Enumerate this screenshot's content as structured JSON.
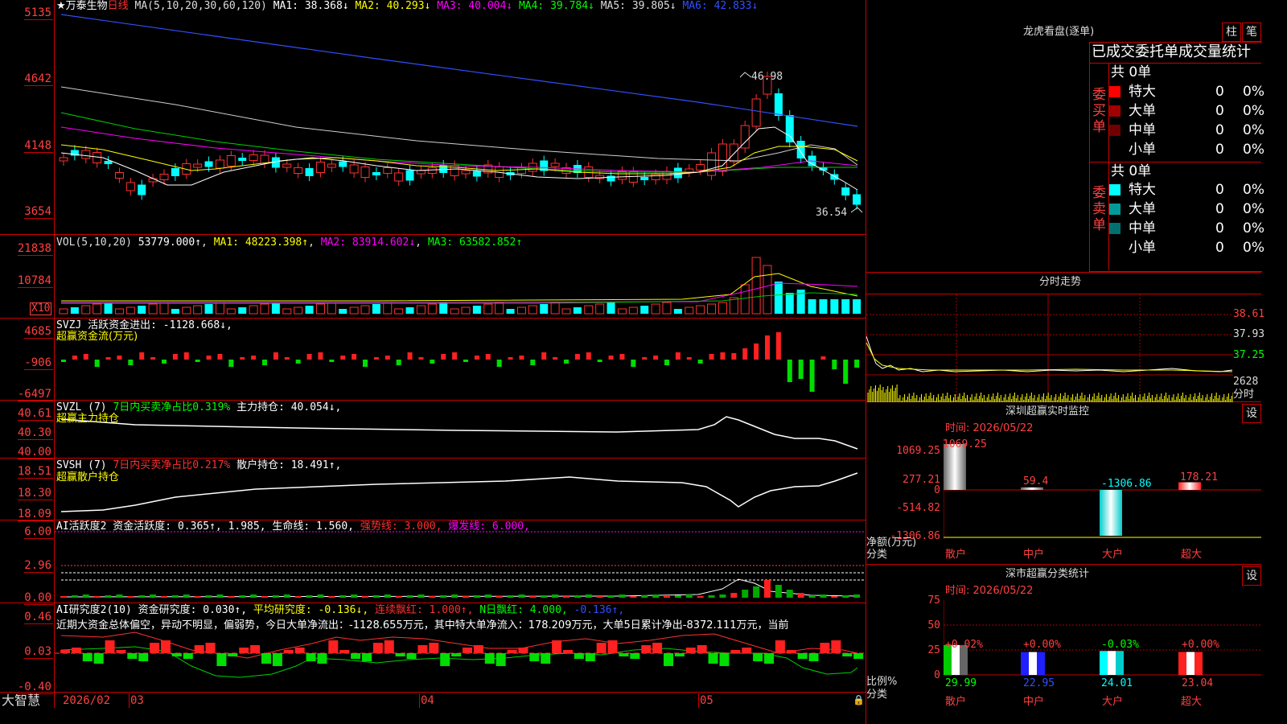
{
  "chart": {
    "stock_name": "★万泰生物",
    "period": "日线",
    "ma_params": "MA(5,10,20,30,60,120)",
    "ma_values": [
      {
        "label": "MA1: 38.368↓",
        "color": "#ffffff"
      },
      {
        "label": "MA2: 40.293↓",
        "color": "#ffff00"
      },
      {
        "label": "MA3: 40.004↓",
        "color": "#ff00ff"
      },
      {
        "label": "MA4: 39.784↓",
        "color": "#00ff00"
      },
      {
        "label": "MA5: 39.805↓",
        "color": "#dddddd"
      },
      {
        "label": "MA6: 42.833↓",
        "color": "#3050ff"
      }
    ],
    "price_axis": [
      "5135",
      "4642",
      "4148",
      "3654"
    ],
    "high_mark": "46.98",
    "low_mark": "36.54",
    "vol_header": "VOL(5,10,20)",
    "vol_value": "53779.000↑",
    "vol_mas": [
      {
        "label": "MA1: 48223.398↑",
        "color": "#ffff00"
      },
      {
        "label": "MA2: 83914.602↓",
        "color": "#ff00ff"
      },
      {
        "label": "MA3: 63582.852↑",
        "color": "#00ff00"
      }
    ],
    "vol_axis": [
      "21838",
      "10784"
    ],
    "vol_unit": "X10",
    "svzj_header": "SVZJ  活跃资金进出: -1128.668↓,",
    "svzj_name": "超赢资金流(万元)",
    "svzj_axis": [
      "4685",
      "-906",
      "-6497"
    ],
    "svzl_header_a": "SVZL (7)",
    "svzl_header_b": "7日内买卖净占比0.319%",
    "svzl_header_c": "主力持仓: 40.054↓,",
    "svzl_name": "超赢主力持仓",
    "svzl_axis": [
      "40.61",
      "40.30",
      "40.00"
    ],
    "svsh_header_a": "SVSH (7)",
    "svsh_header_b": "7日内买卖净占比0.217%",
    "svsh_header_c": "散户持仓: 18.491↑,",
    "svsh_name": "超赢散户持仓",
    "svsh_axis": [
      "18.51",
      "18.30",
      "18.09"
    ],
    "ai1_header_a": "AI活跃度2 资金活跃度: 0.365↑, 1.985, 生命线: 1.560,",
    "ai1_header_b": "强势线: 3.000,",
    "ai1_header_c": "爆发线: 6.000,",
    "ai1_axis": [
      "6.00",
      "2.96",
      "0.00"
    ],
    "ai2_header_a": "AI研究度2(10) 资金研究度: 0.030↑,",
    "ai2_header_b": "平均研究度: -0.136↓,",
    "ai2_header_c": "连续飘红: 1.000↑,",
    "ai2_header_d": "N日飘红: 4.000,",
    "ai2_header_e": "-0.136↑,",
    "ai2_text": "近期大资金总体偏空，异动不明显，偏弱势，今日大单净流出：-1128.655万元，其中特大单净流入：178.209万元，大单5日累计净出-8372.111万元，当前",
    "ai2_axis": [
      "0.46",
      "0.03",
      "-0.40"
    ],
    "date_labels": [
      "2026/02",
      "03",
      "04",
      "05"
    ],
    "brand": "大智慧"
  },
  "longhu": {
    "title": "龙虎看盘(逐单)",
    "btn_zhu": "柱",
    "btn_bi": "笔",
    "tabs": "已成交委托单成交量统计",
    "buy_label": "委买单",
    "sell_label": "委卖单",
    "buy_total": "共 0单",
    "sell_total": "共 0单",
    "buy_rows": [
      {
        "name": "特大",
        "count": "0",
        "pct": "0%",
        "color": "#ff0000"
      },
      {
        "name": "大单",
        "count": "0",
        "pct": "0%",
        "color": "#a00000"
      },
      {
        "name": "中单",
        "count": "0",
        "pct": "0%",
        "color": "#700000"
      },
      {
        "name": "小单",
        "count": "0",
        "pct": "0%",
        "color": ""
      }
    ],
    "sell_rows": [
      {
        "name": "特大",
        "count": "0",
        "pct": "0%",
        "color": "#00ffff"
      },
      {
        "name": "大单",
        "count": "0",
        "pct": "0%",
        "color": "#009a9a"
      },
      {
        "name": "中单",
        "count": "0",
        "pct": "0%",
        "color": "#007070"
      },
      {
        "name": "小单",
        "count": "0",
        "pct": "0%",
        "color": ""
      }
    ]
  },
  "intraday": {
    "title": "分时走势",
    "axis": [
      "38.61",
      "37.93",
      "37.25"
    ],
    "vol_value": "2628",
    "vol_label": "分时"
  },
  "monitor": {
    "title": "深圳超赢实时监控",
    "settings": "设",
    "time": "时间: 2026/05/22",
    "axis": [
      "1069.25",
      "277.21",
      "0",
      "-514.82",
      "-1306.86"
    ],
    "axis_label": "净额(万元)",
    "cat_label": "分类",
    "categories": [
      "散户",
      "中户",
      "大户",
      "超大"
    ],
    "values": [
      "1069.25",
      "59.4",
      "-1306.86",
      "178.21"
    ]
  },
  "classify": {
    "title": "深市超赢分类统计",
    "settings": "设",
    "time": "时间: 2026/05/22",
    "axis": [
      "75",
      "50",
      "25",
      "0"
    ],
    "axis_label": "比例%",
    "cat_label": "分类",
    "categories": [
      "散户",
      "中户",
      "大户",
      "超大"
    ],
    "changes": [
      "+0.02%",
      "+0.00%",
      "-0.03%",
      "+0.00%"
    ],
    "values": [
      "29.99",
      "22.95",
      "24.01",
      "23.04"
    ]
  }
}
